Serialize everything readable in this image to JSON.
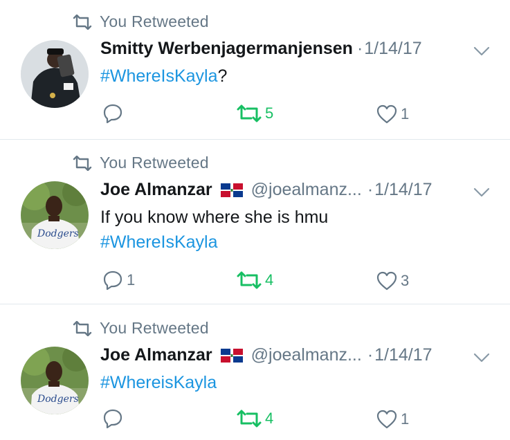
{
  "colors": {
    "link": "#1b95e0",
    "retweet_green": "#17bf63",
    "muted": "#657786",
    "text": "#14171a"
  },
  "tweets": [
    {
      "retweet_label": "You Retweeted",
      "name": "Smitty Werbenjagermanjensen",
      "handle": "",
      "separator": "·",
      "date": "1/14/17",
      "text_lines": [],
      "hashtag": "#WhereIsKayla",
      "hashtag_suffix": "?",
      "replies": "",
      "retweets": "5",
      "likes": "1"
    },
    {
      "retweet_label": "You Retweeted",
      "name": "Joe Almanzar",
      "handle": "@joealmanz...",
      "separator": "·",
      "date": "1/14/17",
      "text_lines": [
        "If you know where she is hmu"
      ],
      "hashtag": "#WhereIsKayla",
      "hashtag_suffix": "",
      "replies": "1",
      "retweets": "4",
      "likes": "3"
    },
    {
      "retweet_label": "You Retweeted",
      "name": "Joe Almanzar",
      "handle": "@joealmanz...",
      "separator": "·",
      "date": "1/14/17",
      "text_lines": [],
      "hashtag": "#WhereisKayla",
      "hashtag_suffix": "",
      "replies": "",
      "retweets": "4",
      "likes": "1"
    }
  ]
}
